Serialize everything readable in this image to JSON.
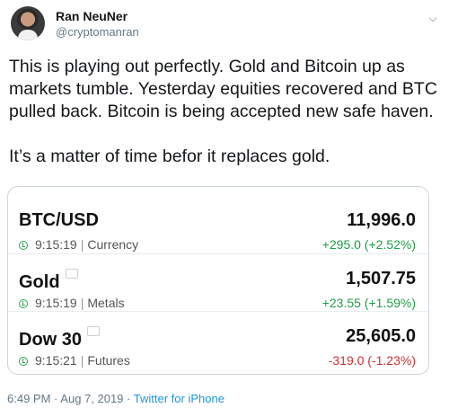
{
  "user": {
    "name": "Ran NeuNer",
    "handle": "@cryptomanran"
  },
  "tweet": {
    "text": "This is playing out perfectly. Gold and Bitcoin up as markets tumble. Yesterday equities recovered and BTC pulled back. Bitcoin is being accepted  new safe haven.\n\nIt’s a matter of time befor it replaces gold."
  },
  "card": {
    "rows": [
      {
        "symbol": "BTC/USD",
        "time": "9:15:19",
        "category": "Currency",
        "price": "11,996.0",
        "change": "+295.0 (+2.52%)",
        "direction": "up"
      },
      {
        "symbol": "Gold",
        "time": "9:15:19",
        "category": "Metals",
        "price": "1,507.75",
        "change": "+23.55 (+1.59%)",
        "direction": "up"
      },
      {
        "symbol": "Dow 30",
        "time": "9:15:21",
        "category": "Futures",
        "price": "25,605.0",
        "change": "-319.0 (-1.23%)",
        "direction": "down"
      }
    ]
  },
  "meta": {
    "time": "6:49 PM",
    "dot1": "·",
    "date": "Aug 7, 2019",
    "dot2": "·",
    "source": "Twitter for iPhone"
  },
  "colors": {
    "up": "#1e9e45",
    "down": "#d32f2f",
    "link": "#1b95e0"
  }
}
